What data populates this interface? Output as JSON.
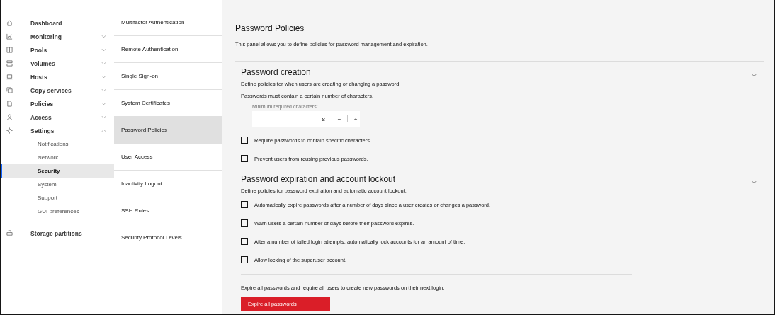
{
  "sidebar": {
    "items": [
      {
        "label": "Dashboard"
      },
      {
        "label": "Monitoring",
        "expanded": false
      },
      {
        "label": "Pools",
        "expanded": false
      },
      {
        "label": "Volumes",
        "expanded": false
      },
      {
        "label": "Hosts",
        "expanded": false
      },
      {
        "label": "Copy services",
        "expanded": false
      },
      {
        "label": "Policies",
        "expanded": false
      },
      {
        "label": "Access",
        "expanded": false
      },
      {
        "label": "Settings",
        "expanded": true,
        "children": [
          {
            "label": "Notifications",
            "selected": false
          },
          {
            "label": "Network",
            "selected": false
          },
          {
            "label": "Security",
            "selected": true
          },
          {
            "label": "System",
            "selected": false
          },
          {
            "label": "Support",
            "selected": false
          },
          {
            "label": "GUI preferences",
            "selected": false
          }
        ]
      }
    ],
    "footer_item": {
      "label": "Storage partitions"
    }
  },
  "subnav": [
    {
      "label": "Multifactor Authentication",
      "selected": false
    },
    {
      "label": "Remote Authentication",
      "selected": false
    },
    {
      "label": "Single Sign-on",
      "selected": false
    },
    {
      "label": "System Certificates",
      "selected": false
    },
    {
      "label": "Password Policies",
      "selected": true
    },
    {
      "label": "User Access",
      "selected": false
    },
    {
      "label": "Inactivity Logout",
      "selected": false
    },
    {
      "label": "SSH Rules",
      "selected": false
    },
    {
      "label": "Security Protocol Levels",
      "selected": false
    }
  ],
  "page": {
    "title": "Password Policies",
    "description": "This panel allows you to define policies for password management and expiration.",
    "sections": [
      {
        "heading": "Password creation",
        "description": "Define policies for when users are creating or changing a password.",
        "intro": "Passwords must contain a certain number of characters.",
        "number_input": {
          "label": "Minimum required characters:",
          "value": "8",
          "decrement": "−",
          "increment": "+"
        },
        "options": [
          {
            "label": "Require passwords to contain specific characters.",
            "checked": false
          },
          {
            "label": "Prevent users from reusing previous passwords.",
            "checked": false
          }
        ]
      },
      {
        "heading": "Password expiration and account lockout",
        "description": "Define policies for password expiration and automatic account lockout.",
        "options": [
          {
            "label": "Automatically expire passwords after a number of days since a user creates or changes a password.",
            "checked": false
          },
          {
            "label": "Warn users a certain number of days before their password expires.",
            "checked": false
          },
          {
            "label": "After a number of failed login attempts, automatically lock accounts for an amount of time.",
            "checked": false
          },
          {
            "label": "Allow locking of the superuser account.",
            "checked": false
          }
        ],
        "footer_text": "Expire all passwords and require all users to create new passwords on their next login.",
        "button": "Expire all passwords"
      }
    ]
  }
}
